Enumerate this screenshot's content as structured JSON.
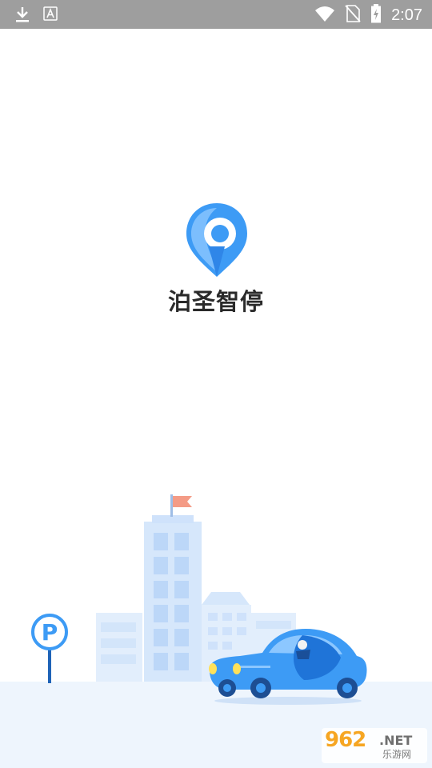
{
  "status_bar": {
    "time": "2:07",
    "left_icons": [
      "download-icon",
      "text-a-icon"
    ],
    "right_icons": [
      "wifi-icon",
      "no-sim-icon",
      "battery-charging-icon"
    ]
  },
  "splash": {
    "app_name": "泊圣智停",
    "logo_icon": "location-pin-logo",
    "illustration": [
      "parking-sign-icon",
      "buildings",
      "blue-car"
    ]
  },
  "watermark": {
    "number": "962",
    "domain": ".NET",
    "name": "乐游网"
  },
  "colors": {
    "brand_blue": "#3d9bf5",
    "status_bar": "#9e9e9e",
    "building_light": "#dbe9fb",
    "ground": "#eef5fd",
    "flag": "#f49b86"
  }
}
